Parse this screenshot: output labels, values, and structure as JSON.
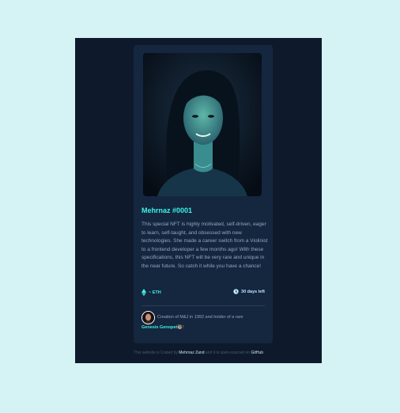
{
  "card": {
    "title": "Mehrnaz #0001",
    "description": "This special NFT is highly motivated, self-driven, eager to learn, self-taught, and obsessed with new technologies. She made a career switch from a Violinist to a frontend developer a few months ago! With these specifications, this NFT will be very rare and unique in the near future. So catch it while you have a chance!",
    "price": "~ ETH",
    "time_left": "30 days left",
    "creator_line1": "Creation of M&J in 1992 and holder of a rare",
    "creator_name": "Genesis Genopet",
    "creator_suffix": "🦥!",
    "icons": {
      "price": "ethereum-icon",
      "time": "clock-icon"
    }
  },
  "footer": {
    "prefix": "This website is Crated by",
    "author": "Mehrnaz Zand",
    "middle": "and it is open-sourced on",
    "repo": "GitHub"
  },
  "colors": {
    "page_bg": "#d5f2f5",
    "stage_bg": "#0e1a2b",
    "card_bg": "#15263f",
    "accent": "#3cf2e7"
  }
}
